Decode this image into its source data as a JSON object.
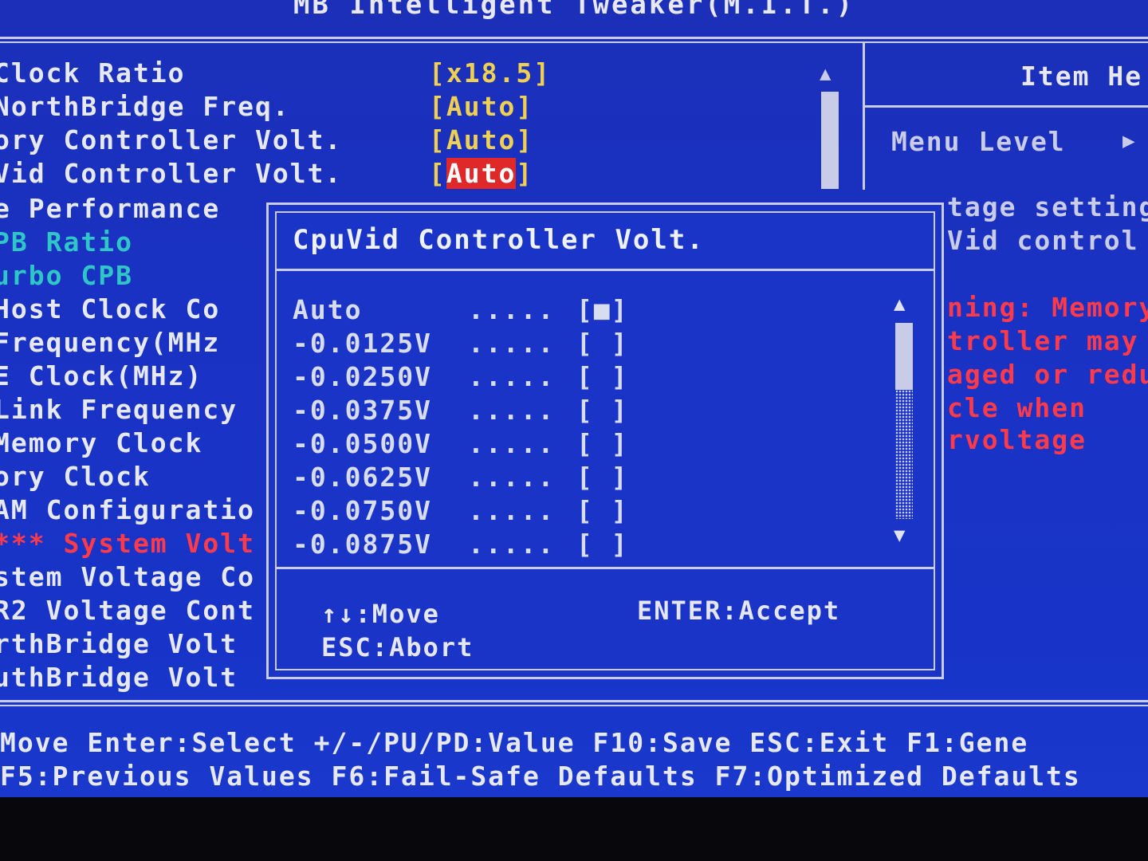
{
  "window": {
    "title": "MB Intelligent Tweaker(M.I.T.)"
  },
  "settings": [
    {
      "label": "Clock Ratio",
      "value": "[x18.5]",
      "color": "white"
    },
    {
      "label": "NorthBridge Freq.",
      "value": "[Auto]",
      "color": "white"
    },
    {
      "label": "ory Controller Volt.",
      "value": "[Auto]",
      "color": "white"
    },
    {
      "label": "Vid Controller Volt.",
      "value_pre": "[",
      "value_hl": "Auto",
      "value_post": "]",
      "color": "white"
    },
    {
      "label": "e Performance",
      "value": "",
      "color": "white"
    },
    {
      "label": "PB Ratio",
      "value": "",
      "color": "cyan"
    },
    {
      "label": "urbo CPB",
      "value": "",
      "color": "cyan"
    },
    {
      "label": "Host Clock Co",
      "value": "",
      "color": "white"
    },
    {
      "label": "Frequency(MHz",
      "value": "",
      "color": "white"
    },
    {
      "label": "E Clock(MHz)",
      "value": "",
      "color": "white"
    },
    {
      "label": "Link Frequency",
      "value": "",
      "color": "white"
    },
    {
      "label": "Memory Clock",
      "value": "",
      "color": "white"
    },
    {
      "label": "ory Clock",
      "value": "",
      "color": "white"
    },
    {
      "label": "AM Configuratio",
      "value": "",
      "color": "white"
    },
    {
      "label": "*** System Volt",
      "value": "",
      "color": "red"
    },
    {
      "label": "stem Voltage Co",
      "value": "",
      "color": "white"
    },
    {
      "label": "R2 Voltage Cont",
      "value": "",
      "color": "white"
    },
    {
      "label": "rthBridge Volt",
      "value": "",
      "color": "white"
    },
    {
      "label": "uthBridge Volt",
      "value": "",
      "color": "white"
    }
  ],
  "help_panel": {
    "header": "Item He",
    "menu_level": "Menu Level",
    "lines_white": [
      "tage setting",
      "Vid control"
    ],
    "lines_red": [
      "ning: Memory",
      "troller may",
      "aged or redu",
      "cle when",
      "rvoltage"
    ]
  },
  "dialog": {
    "title": "CpuVid Controller Volt.",
    "options": [
      {
        "label": "Auto",
        "dots": ".....",
        "box": "[■]"
      },
      {
        "label": "-0.0125V",
        "dots": ".....",
        "box": "[ ]"
      },
      {
        "label": "-0.0250V",
        "dots": ".....",
        "box": "[ ]"
      },
      {
        "label": "-0.0375V",
        "dots": ".....",
        "box": "[ ]"
      },
      {
        "label": "-0.0500V",
        "dots": ".....",
        "box": "[ ]"
      },
      {
        "label": "-0.0625V",
        "dots": ".....",
        "box": "[ ]"
      },
      {
        "label": "-0.0750V",
        "dots": ".....",
        "box": "[ ]"
      },
      {
        "label": "-0.0875V",
        "dots": ".....",
        "box": "[ ]"
      }
    ],
    "hints": {
      "move": "↑↓:Move",
      "accept": "ENTER:Accept",
      "abort": "ESC:Abort"
    }
  },
  "footer": {
    "line1": "Move  Enter:Select  +/-/PU/PD:Value  F10:Save  ESC:Exit  F1:Gene",
    "line2": "F5:Previous Values  F6:Fail-Safe Defaults  F7:Optimized Defaults"
  },
  "colors": {
    "background": "#1a34c8",
    "value": "#f0d050",
    "highlight": "#e02828",
    "warning": "#ff3a4a",
    "cyan": "#2fc6c8"
  }
}
